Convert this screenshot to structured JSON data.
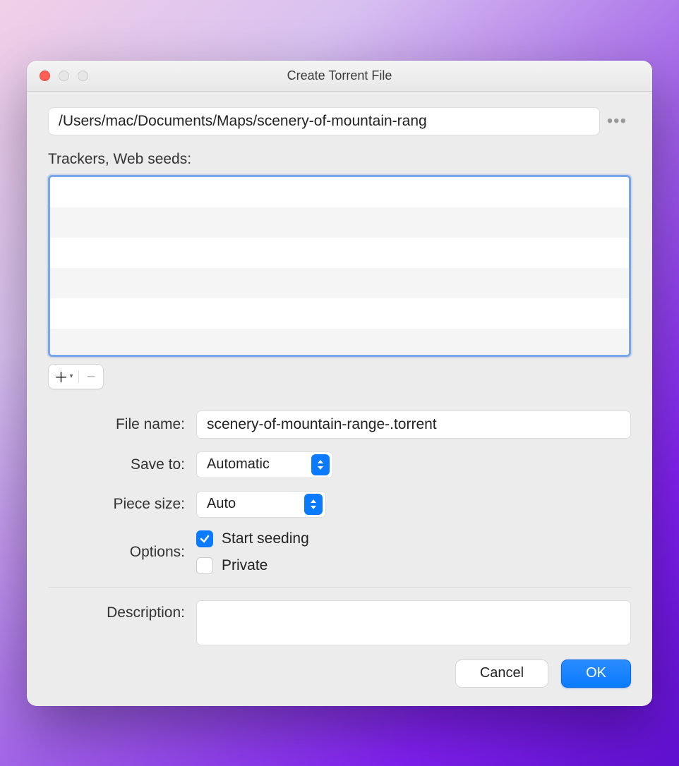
{
  "window": {
    "title": "Create Torrent File"
  },
  "path": {
    "value": "/Users/mac/Documents/Maps/scenery-of-mountain-rang"
  },
  "trackers": {
    "label": "Trackers, Web seeds:"
  },
  "form": {
    "filename_label": "File name:",
    "filename_value": "scenery-of-mountain-range-.torrent",
    "saveto_label": "Save to:",
    "saveto_value": "Automatic",
    "piecesize_label": "Piece size:",
    "piecesize_value": "Auto",
    "options_label": "Options:",
    "option_start_seeding": "Start seeding",
    "option_private": "Private",
    "description_label": "Description:"
  },
  "buttons": {
    "cancel": "Cancel",
    "ok": "OK"
  }
}
